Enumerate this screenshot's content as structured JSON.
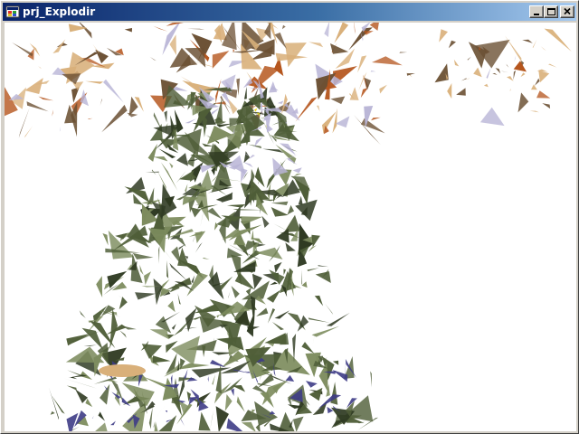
{
  "window": {
    "title": "prj_Explodir",
    "icon": "app-icon",
    "controls": [
      {
        "name": "minimize-button",
        "icon": "minimize-icon"
      },
      {
        "name": "maximize-button",
        "icon": "maximize-icon"
      },
      {
        "name": "close-button",
        "icon": "close-icon"
      }
    ]
  },
  "viewport": {
    "background": "#ffffff",
    "scene": "exploding-mesh",
    "colors": {
      "foliage": "#4f5e38",
      "foliage_light": "#7d8c5e",
      "foliage_dark": "#2f3a22",
      "wood": "#6b5033",
      "tan": "#d9b07a",
      "rust": "#b5551d",
      "blue": "#3e3c86",
      "lavender": "#b8b4d6",
      "yellow": "#e8d81c"
    }
  }
}
